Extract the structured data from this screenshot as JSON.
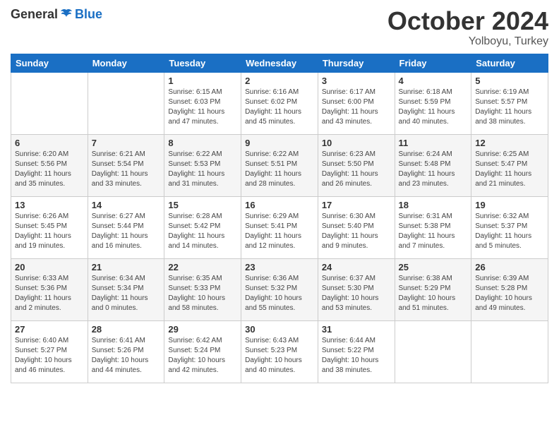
{
  "header": {
    "logo_general": "General",
    "logo_blue": "Blue",
    "month": "October 2024",
    "location": "Yolboyu, Turkey"
  },
  "weekdays": [
    "Sunday",
    "Monday",
    "Tuesday",
    "Wednesday",
    "Thursday",
    "Friday",
    "Saturday"
  ],
  "weeks": [
    [
      {
        "day": "",
        "sunrise": "",
        "sunset": "",
        "daylight": ""
      },
      {
        "day": "",
        "sunrise": "",
        "sunset": "",
        "daylight": ""
      },
      {
        "day": "1",
        "sunrise": "Sunrise: 6:15 AM",
        "sunset": "Sunset: 6:03 PM",
        "daylight": "Daylight: 11 hours and 47 minutes."
      },
      {
        "day": "2",
        "sunrise": "Sunrise: 6:16 AM",
        "sunset": "Sunset: 6:02 PM",
        "daylight": "Daylight: 11 hours and 45 minutes."
      },
      {
        "day": "3",
        "sunrise": "Sunrise: 6:17 AM",
        "sunset": "Sunset: 6:00 PM",
        "daylight": "Daylight: 11 hours and 43 minutes."
      },
      {
        "day": "4",
        "sunrise": "Sunrise: 6:18 AM",
        "sunset": "Sunset: 5:59 PM",
        "daylight": "Daylight: 11 hours and 40 minutes."
      },
      {
        "day": "5",
        "sunrise": "Sunrise: 6:19 AM",
        "sunset": "Sunset: 5:57 PM",
        "daylight": "Daylight: 11 hours and 38 minutes."
      }
    ],
    [
      {
        "day": "6",
        "sunrise": "Sunrise: 6:20 AM",
        "sunset": "Sunset: 5:56 PM",
        "daylight": "Daylight: 11 hours and 35 minutes."
      },
      {
        "day": "7",
        "sunrise": "Sunrise: 6:21 AM",
        "sunset": "Sunset: 5:54 PM",
        "daylight": "Daylight: 11 hours and 33 minutes."
      },
      {
        "day": "8",
        "sunrise": "Sunrise: 6:22 AM",
        "sunset": "Sunset: 5:53 PM",
        "daylight": "Daylight: 11 hours and 31 minutes."
      },
      {
        "day": "9",
        "sunrise": "Sunrise: 6:22 AM",
        "sunset": "Sunset: 5:51 PM",
        "daylight": "Daylight: 11 hours and 28 minutes."
      },
      {
        "day": "10",
        "sunrise": "Sunrise: 6:23 AM",
        "sunset": "Sunset: 5:50 PM",
        "daylight": "Daylight: 11 hours and 26 minutes."
      },
      {
        "day": "11",
        "sunrise": "Sunrise: 6:24 AM",
        "sunset": "Sunset: 5:48 PM",
        "daylight": "Daylight: 11 hours and 23 minutes."
      },
      {
        "day": "12",
        "sunrise": "Sunrise: 6:25 AM",
        "sunset": "Sunset: 5:47 PM",
        "daylight": "Daylight: 11 hours and 21 minutes."
      }
    ],
    [
      {
        "day": "13",
        "sunrise": "Sunrise: 6:26 AM",
        "sunset": "Sunset: 5:45 PM",
        "daylight": "Daylight: 11 hours and 19 minutes."
      },
      {
        "day": "14",
        "sunrise": "Sunrise: 6:27 AM",
        "sunset": "Sunset: 5:44 PM",
        "daylight": "Daylight: 11 hours and 16 minutes."
      },
      {
        "day": "15",
        "sunrise": "Sunrise: 6:28 AM",
        "sunset": "Sunset: 5:42 PM",
        "daylight": "Daylight: 11 hours and 14 minutes."
      },
      {
        "day": "16",
        "sunrise": "Sunrise: 6:29 AM",
        "sunset": "Sunset: 5:41 PM",
        "daylight": "Daylight: 11 hours and 12 minutes."
      },
      {
        "day": "17",
        "sunrise": "Sunrise: 6:30 AM",
        "sunset": "Sunset: 5:40 PM",
        "daylight": "Daylight: 11 hours and 9 minutes."
      },
      {
        "day": "18",
        "sunrise": "Sunrise: 6:31 AM",
        "sunset": "Sunset: 5:38 PM",
        "daylight": "Daylight: 11 hours and 7 minutes."
      },
      {
        "day": "19",
        "sunrise": "Sunrise: 6:32 AM",
        "sunset": "Sunset: 5:37 PM",
        "daylight": "Daylight: 11 hours and 5 minutes."
      }
    ],
    [
      {
        "day": "20",
        "sunrise": "Sunrise: 6:33 AM",
        "sunset": "Sunset: 5:36 PM",
        "daylight": "Daylight: 11 hours and 2 minutes."
      },
      {
        "day": "21",
        "sunrise": "Sunrise: 6:34 AM",
        "sunset": "Sunset: 5:34 PM",
        "daylight": "Daylight: 11 hours and 0 minutes."
      },
      {
        "day": "22",
        "sunrise": "Sunrise: 6:35 AM",
        "sunset": "Sunset: 5:33 PM",
        "daylight": "Daylight: 10 hours and 58 minutes."
      },
      {
        "day": "23",
        "sunrise": "Sunrise: 6:36 AM",
        "sunset": "Sunset: 5:32 PM",
        "daylight": "Daylight: 10 hours and 55 minutes."
      },
      {
        "day": "24",
        "sunrise": "Sunrise: 6:37 AM",
        "sunset": "Sunset: 5:30 PM",
        "daylight": "Daylight: 10 hours and 53 minutes."
      },
      {
        "day": "25",
        "sunrise": "Sunrise: 6:38 AM",
        "sunset": "Sunset: 5:29 PM",
        "daylight": "Daylight: 10 hours and 51 minutes."
      },
      {
        "day": "26",
        "sunrise": "Sunrise: 6:39 AM",
        "sunset": "Sunset: 5:28 PM",
        "daylight": "Daylight: 10 hours and 49 minutes."
      }
    ],
    [
      {
        "day": "27",
        "sunrise": "Sunrise: 6:40 AM",
        "sunset": "Sunset: 5:27 PM",
        "daylight": "Daylight: 10 hours and 46 minutes."
      },
      {
        "day": "28",
        "sunrise": "Sunrise: 6:41 AM",
        "sunset": "Sunset: 5:26 PM",
        "daylight": "Daylight: 10 hours and 44 minutes."
      },
      {
        "day": "29",
        "sunrise": "Sunrise: 6:42 AM",
        "sunset": "Sunset: 5:24 PM",
        "daylight": "Daylight: 10 hours and 42 minutes."
      },
      {
        "day": "30",
        "sunrise": "Sunrise: 6:43 AM",
        "sunset": "Sunset: 5:23 PM",
        "daylight": "Daylight: 10 hours and 40 minutes."
      },
      {
        "day": "31",
        "sunrise": "Sunrise: 6:44 AM",
        "sunset": "Sunset: 5:22 PM",
        "daylight": "Daylight: 10 hours and 38 minutes."
      },
      {
        "day": "",
        "sunrise": "",
        "sunset": "",
        "daylight": ""
      },
      {
        "day": "",
        "sunrise": "",
        "sunset": "",
        "daylight": ""
      }
    ]
  ]
}
